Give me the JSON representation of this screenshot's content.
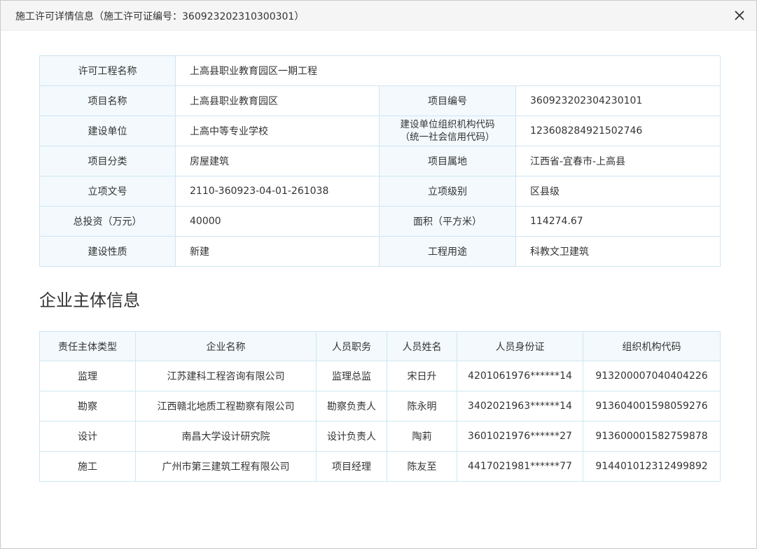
{
  "dialog": {
    "title": "施工许可详情信息（施工许可证编号：360923202310300301）"
  },
  "project_info": {
    "permit_project_name_label": "许可工程名称",
    "permit_project_name": "上高县职业教育园区一期工程",
    "rows": [
      {
        "label1": "项目名称",
        "value1": "上高县职业教育园区",
        "label2": "项目编号",
        "value2": "360923202304230101"
      },
      {
        "label1": "建设单位",
        "value1": "上高中等专业学校",
        "label2a": "建设单位组织机构代码",
        "label2b": "（统一社会信用代码）",
        "value2": "123608284921502746"
      },
      {
        "label1": "项目分类",
        "value1": "房屋建筑",
        "label2": "项目属地",
        "value2": "江西省-宜春市-上高县"
      },
      {
        "label1": "立项文号",
        "value1": "2110-360923-04-01-261038",
        "label2": "立项级别",
        "value2": "区县级"
      },
      {
        "label1": "总投资（万元）",
        "value1": "40000",
        "label2": "面积（平方米）",
        "value2": "114274.67"
      },
      {
        "label1": "建设性质",
        "value1": "新建",
        "label2": "工程用途",
        "value2": "科教文卫建筑"
      }
    ]
  },
  "enterprise_section": {
    "title": "企业主体信息",
    "columns": [
      "责任主体类型",
      "企业名称",
      "人员职务",
      "人员姓名",
      "人员身份证",
      "组织机构代码"
    ],
    "rows": [
      [
        "监理",
        "江苏建科工程咨询有限公司",
        "监理总监",
        "宋日升",
        "4201061976******14",
        "913200007040404226"
      ],
      [
        "勘察",
        "江西赣北地质工程勘察有限公司",
        "勘察负责人",
        "陈永明",
        "3402021963******14",
        "913604001598059276"
      ],
      [
        "设计",
        "南昌大学设计研究院",
        "设计负责人",
        "陶莉",
        "3601021976******27",
        "913600001582759878"
      ],
      [
        "施工",
        "广州市第三建筑工程有限公司",
        "项目经理",
        "陈友至",
        "4417021981******77",
        "914401012312499892"
      ]
    ]
  }
}
